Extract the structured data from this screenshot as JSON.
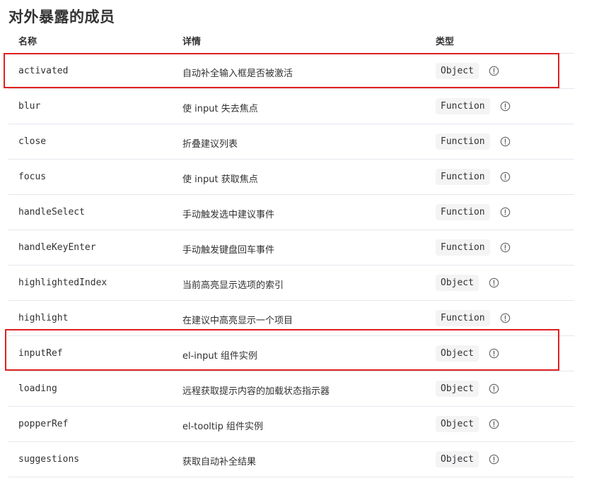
{
  "title": "对外暴露的成员",
  "columns": {
    "name": "名称",
    "details": "详情",
    "type": "类型"
  },
  "rows": [
    {
      "name": "activated",
      "desc": "自动补全输入框是否被激活",
      "type": "Object"
    },
    {
      "name": "blur",
      "desc": "使 input 失去焦点",
      "type": "Function"
    },
    {
      "name": "close",
      "desc": "折叠建议列表",
      "type": "Function"
    },
    {
      "name": "focus",
      "desc": "使 input 获取焦点",
      "type": "Function"
    },
    {
      "name": "handleSelect",
      "desc": "手动触发选中建议事件",
      "type": "Function"
    },
    {
      "name": "handleKeyEnter",
      "desc": "手动触发键盘回车事件",
      "type": "Function"
    },
    {
      "name": "highlightedIndex",
      "desc": "当前高亮显示选项的索引",
      "type": "Object"
    },
    {
      "name": "highlight",
      "desc": "在建议中高亮显示一个项目",
      "type": "Function"
    },
    {
      "name": "inputRef",
      "desc": "el-input 组件实例",
      "type": "Object"
    },
    {
      "name": "loading",
      "desc": "远程获取提示内容的加载状态指示器",
      "type": "Object"
    },
    {
      "name": "popperRef",
      "desc": "el-tooltip 组件实例",
      "type": "Object"
    },
    {
      "name": "suggestions",
      "desc": "获取自动补全结果",
      "type": "Object"
    }
  ],
  "icons": {
    "info": "info-circle-icon"
  },
  "colors": {
    "highlight_box": "#e02020",
    "tag_bg": "#f4f4f5",
    "row_border": "#e4e7ed"
  }
}
